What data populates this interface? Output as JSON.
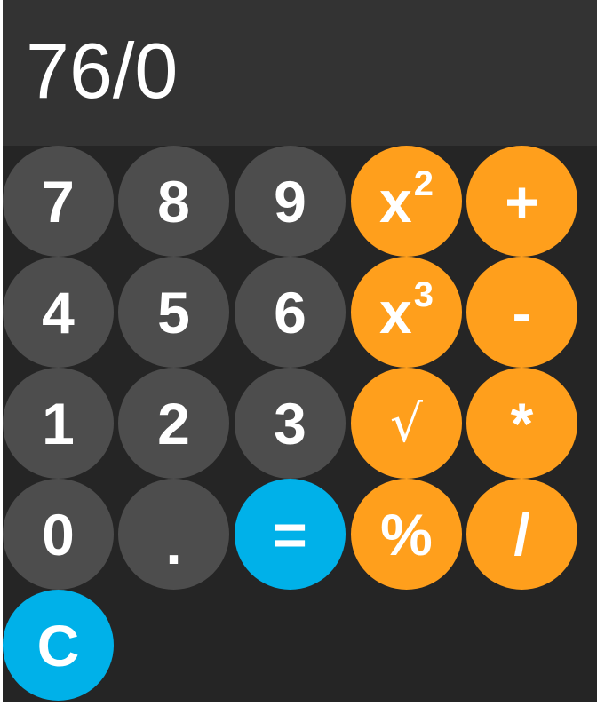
{
  "display": {
    "value": "76/0"
  },
  "colors": {
    "app_background": "#252525",
    "display_background": "#333333",
    "number_key": "#4d4d4d",
    "operator_key": "#ff9f1c",
    "action_key": "#00b1e9",
    "text": "#ffffff"
  },
  "keys": {
    "seven": "7",
    "eight": "8",
    "nine": "9",
    "square_base": "x",
    "square_sup": "2",
    "plus": "+",
    "four": "4",
    "five": "5",
    "six": "6",
    "cube_base": "x",
    "cube_sup": "3",
    "minus": "-",
    "one": "1",
    "two": "2",
    "three": "3",
    "sqrt": "√",
    "multiply": "*",
    "zero": "0",
    "decimal": ".",
    "equals": "=",
    "percent": "%",
    "divide": "/",
    "clear": "C"
  }
}
